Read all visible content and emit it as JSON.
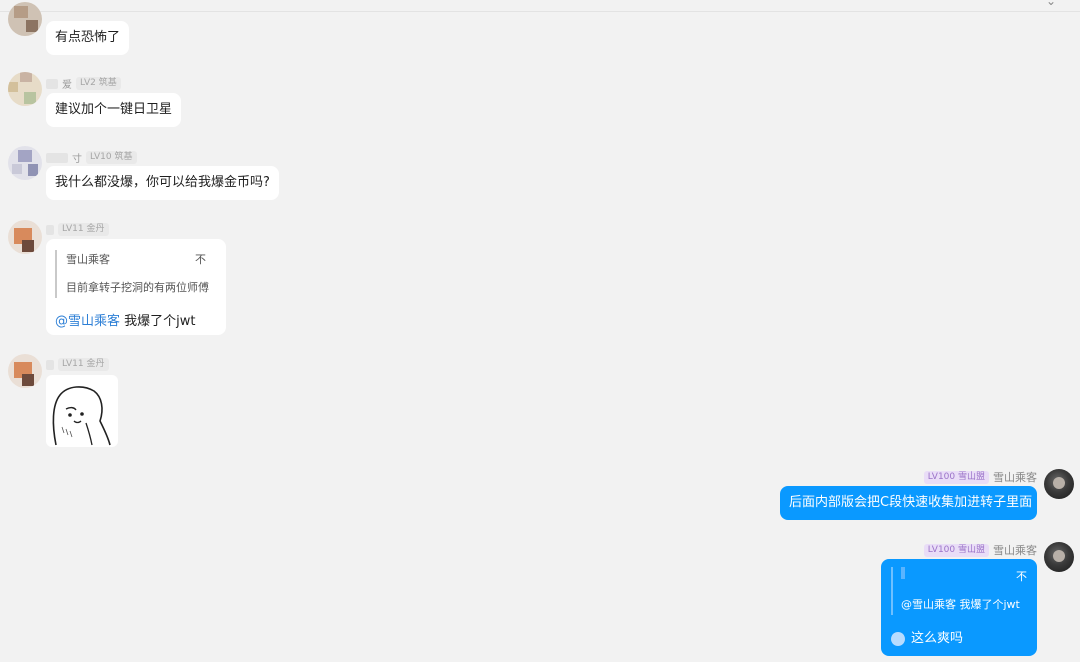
{
  "messages": [
    {
      "id": 1,
      "level": "",
      "text": "有点恐怖了"
    },
    {
      "id": 2,
      "name_tail": "爱",
      "level": "LV2 筑基",
      "text": "建议加个一键日卫星"
    },
    {
      "id": 3,
      "name_tail": "寸",
      "level": "LV10 筑基",
      "text": "我什么都没爆，你可以给我爆金币吗?"
    },
    {
      "id": 4,
      "level": "LV11 金丹",
      "quote_author": "雪山乘客",
      "quote_suffix": "不",
      "quote_text": "目前拿转子挖洞的有两位师傅",
      "mention": "@雪山乘客",
      "text": "我爆了个jwt"
    },
    {
      "id": 5,
      "level": "LV11 金丹",
      "sticker": "doodle-sticker"
    }
  ],
  "self_messages": [
    {
      "id": 6,
      "level": "LV100 雪山盟",
      "name": "雪山乘客",
      "text": "后面内部版会把C段快速收集加进转子里面"
    },
    {
      "id": 7,
      "level": "LV100 雪山盟",
      "name": "雪山乘客",
      "quote_suffix": "不",
      "quote_text": "@雪山乘客 我爆了个jwt",
      "text": "这么爽吗"
    }
  ],
  "colors": {
    "self_bubble": "#0a99ff",
    "mention": "#2d7fd6",
    "background": "#f2f2f2"
  }
}
